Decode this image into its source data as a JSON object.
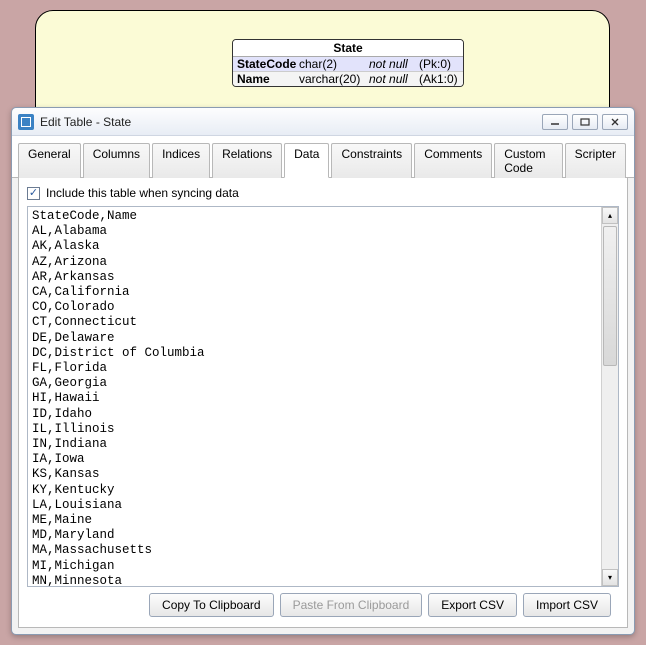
{
  "schema": {
    "title": "State",
    "columns": [
      {
        "name": "StateCode",
        "type": "char(2)",
        "nullability": "not null",
        "key": "(Pk:0)"
      },
      {
        "name": "Name",
        "type": "varchar(20)",
        "nullability": "not null",
        "key": "(Ak1:0)"
      }
    ]
  },
  "dialog": {
    "title": "Edit Table - State",
    "tabs": [
      "General",
      "Columns",
      "Indices",
      "Relations",
      "Data",
      "Constraints",
      "Comments",
      "Custom Code",
      "Scripter"
    ],
    "active_tab": "Data",
    "include_checkbox": {
      "checked": true,
      "label": "Include this table when syncing data"
    },
    "csv_text": "StateCode,Name\nAL,Alabama\nAK,Alaska\nAZ,Arizona\nAR,Arkansas\nCA,California\nCO,Colorado\nCT,Connecticut\nDE,Delaware\nDC,District of Columbia\nFL,Florida\nGA,Georgia\nHI,Hawaii\nID,Idaho\nIL,Illinois\nIN,Indiana\nIA,Iowa\nKS,Kansas\nKY,Kentucky\nLA,Louisiana\nME,Maine\nMD,Maryland\nMA,Massachusetts\nMI,Michigan\nMN,Minnesota\nMS,Mississippi\nMO,Missouri\nMT,Montana",
    "buttons": {
      "copy": "Copy To Clipboard",
      "paste": "Paste From Clipboard",
      "export": "Export CSV",
      "import": "Import CSV"
    }
  }
}
